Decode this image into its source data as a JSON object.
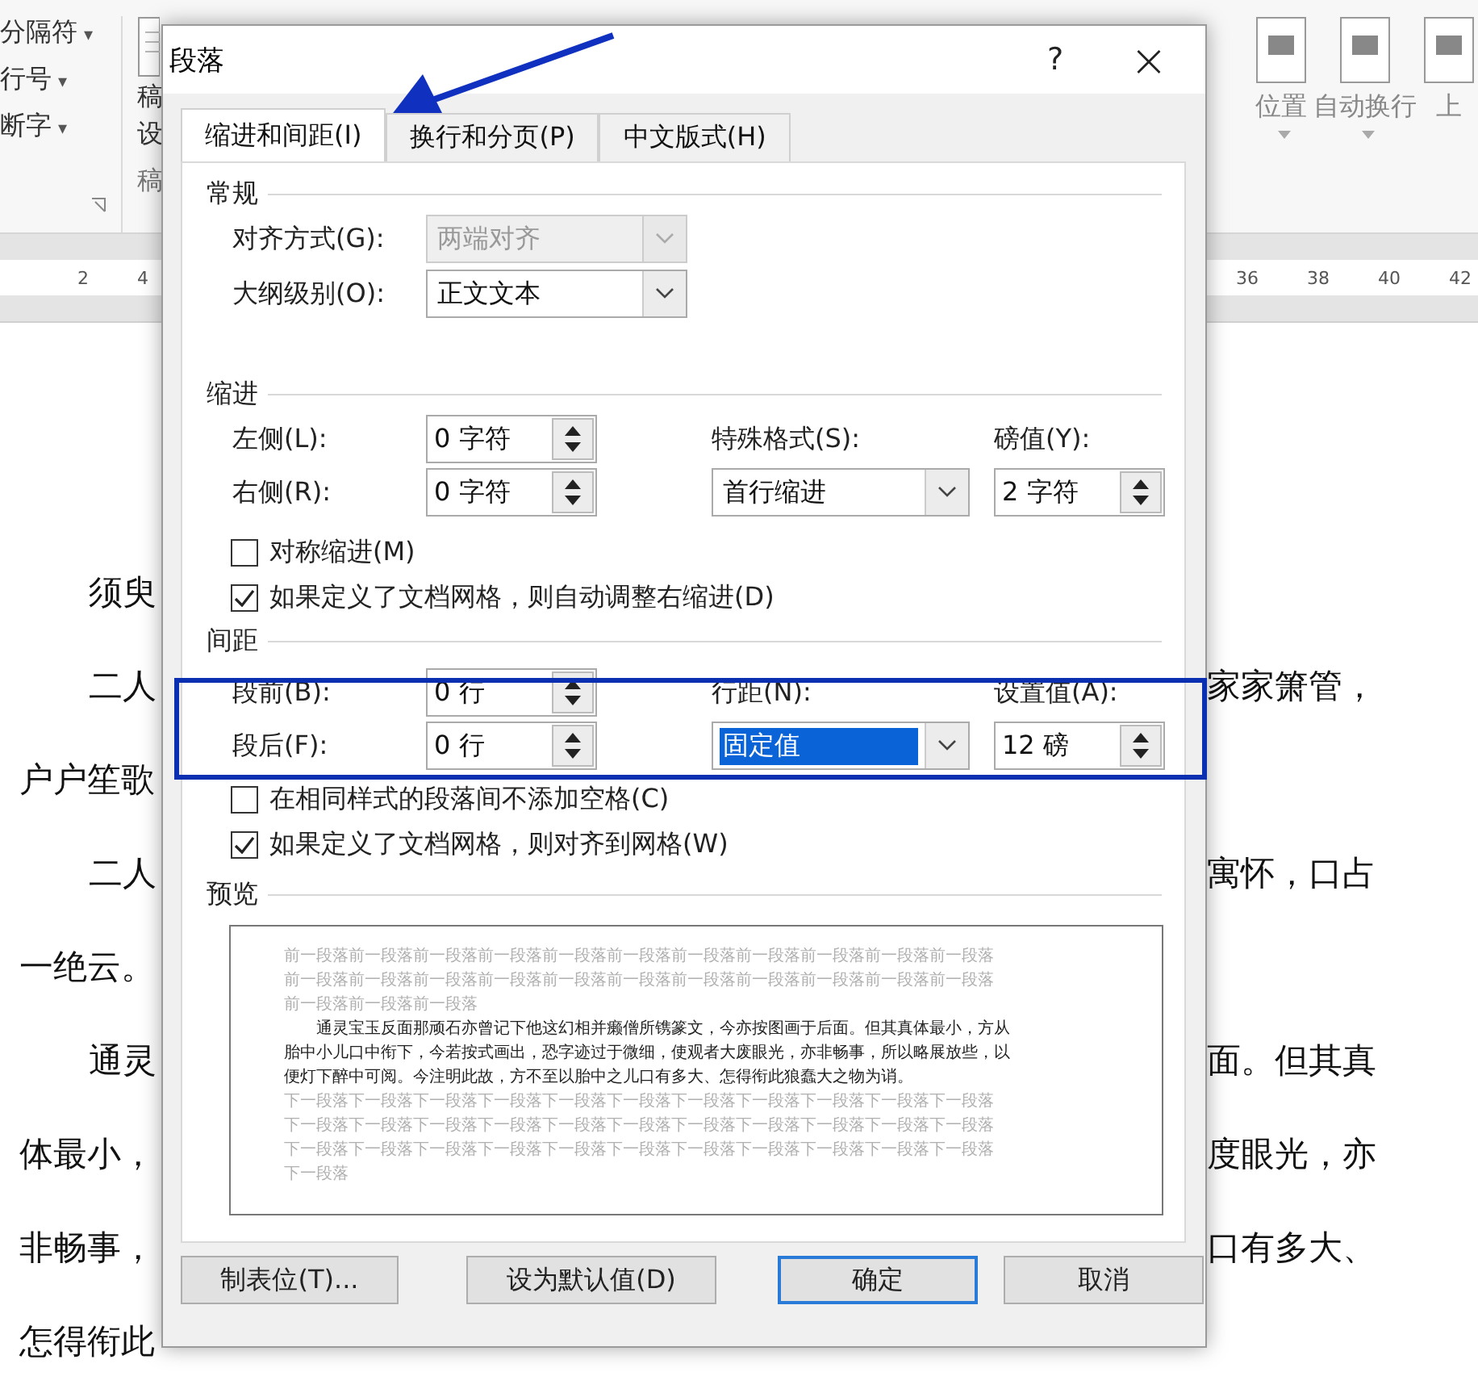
{
  "ribbon": {
    "left_items": [
      {
        "label": "分隔符",
        "caret": "▾"
      },
      {
        "label": "行号",
        "caret": "▾"
      },
      {
        "label": "断字",
        "caret": "▾"
      }
    ],
    "group_button": {
      "lines": [
        "稿",
        "设"
      ],
      "group_label": "稿"
    },
    "right_items": [
      {
        "label": "位置",
        "caret": true
      },
      {
        "label": "自动换行",
        "caret": true
      },
      {
        "label": "上",
        "caret": false
      }
    ]
  },
  "ruler": {
    "left_ticks": [
      "2",
      "4"
    ],
    "right_ticks": [
      "36",
      "38",
      "40",
      "42"
    ]
  },
  "document": {
    "lines": [
      {
        "left": "须臾",
        "indent": true
      },
      {
        "left": "二人",
        "right": "家家箫管，",
        "indent": true
      },
      {
        "left": "户户笙歌",
        "indent": false
      },
      {
        "left": "二人",
        "right": "寓怀，口占",
        "indent": true
      },
      {
        "left": "一绝云。",
        "indent": false
      },
      {
        "left": "通灵",
        "right": "面。但其真",
        "indent": true
      },
      {
        "left": "体最小，",
        "right": "度眼光，亦",
        "indent": false
      },
      {
        "left": "非畅事，",
        "right": "口有多大、",
        "indent": false
      },
      {
        "left": "怎得衔此",
        "indent": false
      }
    ]
  },
  "dialog": {
    "title": "段落",
    "help": "?",
    "close": "×",
    "tabs": [
      {
        "label": "缩进和间距(I)",
        "selected": true
      },
      {
        "label": "换行和分页(P)",
        "selected": false
      },
      {
        "label": "中文版式(H)",
        "selected": false
      }
    ],
    "general": {
      "heading": "常规",
      "rows": [
        {
          "label": "对齐方式(G):",
          "value": "两端对齐",
          "disabled": true
        },
        {
          "label": "大纲级别(O):",
          "value": "正文文本",
          "disabled": false
        }
      ]
    },
    "indent": {
      "heading": "缩进",
      "left": {
        "label": "左侧(L):",
        "value": "0 字符"
      },
      "right": {
        "label": "右侧(R):",
        "value": "0 字符"
      },
      "special": {
        "label": "特殊格式(S):",
        "value": "首行缩进",
        "highlighted": false
      },
      "by": {
        "label": "磅值(Y):",
        "value": "2 字符"
      },
      "checks": [
        {
          "label": "对称缩进(M)",
          "checked": false
        },
        {
          "label": "如果定义了文档网格，则自动调整右缩进(D)",
          "checked": true
        }
      ]
    },
    "spacing": {
      "heading": "间距",
      "before": {
        "label": "段前(B):",
        "value": "0 行"
      },
      "after": {
        "label": "段后(F):",
        "value": "0 行"
      },
      "line": {
        "label": "行距(N):",
        "value": "固定值",
        "highlighted": true
      },
      "at": {
        "label": "设置值(A):",
        "value": "12 磅"
      },
      "checks": [
        {
          "label": "在相同样式的段落间不添加空格(C)",
          "checked": false
        },
        {
          "label": "如果定义了文档网格，则对齐到网格(W)",
          "checked": true
        }
      ]
    },
    "preview": {
      "heading": "预览",
      "before_lines": [
        "前一段落前一段落前一段落前一段落前一段落前一段落前一段落前一段落前一段落前一段落前一段落",
        "前一段落前一段落前一段落前一段落前一段落前一段落前一段落前一段落前一段落前一段落前一段落",
        "前一段落前一段落前一段落"
      ],
      "main_lines": [
        "通灵宝玉反面那顽石亦曾记下他这幻相并癞僧所镌篆文，今亦按图画于后面。但其真体最小，方从",
        "胎中小儿口中衔下，今若按式画出，恐字迹过于微细，使观者大废眼光，亦非畅事，所以略展放些，以",
        "便灯下醉中可阅。今注明此故，方不至以胎中之儿口有多大、怎得衔此狼蠢大之物为诮。"
      ],
      "after_lines": [
        "下一段落下一段落下一段落下一段落下一段落下一段落下一段落下一段落下一段落下一段落下一段落",
        "下一段落下一段落下一段落下一段落下一段落下一段落下一段落下一段落下一段落下一段落下一段落",
        "下一段落下一段落下一段落下一段落下一段落下一段落下一段落下一段落下一段落下一段落下一段落",
        "下一段落"
      ]
    },
    "buttons": [
      {
        "label": "制表位(T)...",
        "default": false
      },
      {
        "label": "设为默认值(D)",
        "default": false
      },
      {
        "label": "确定",
        "default": true
      },
      {
        "label": "取消",
        "default": false
      }
    ]
  }
}
